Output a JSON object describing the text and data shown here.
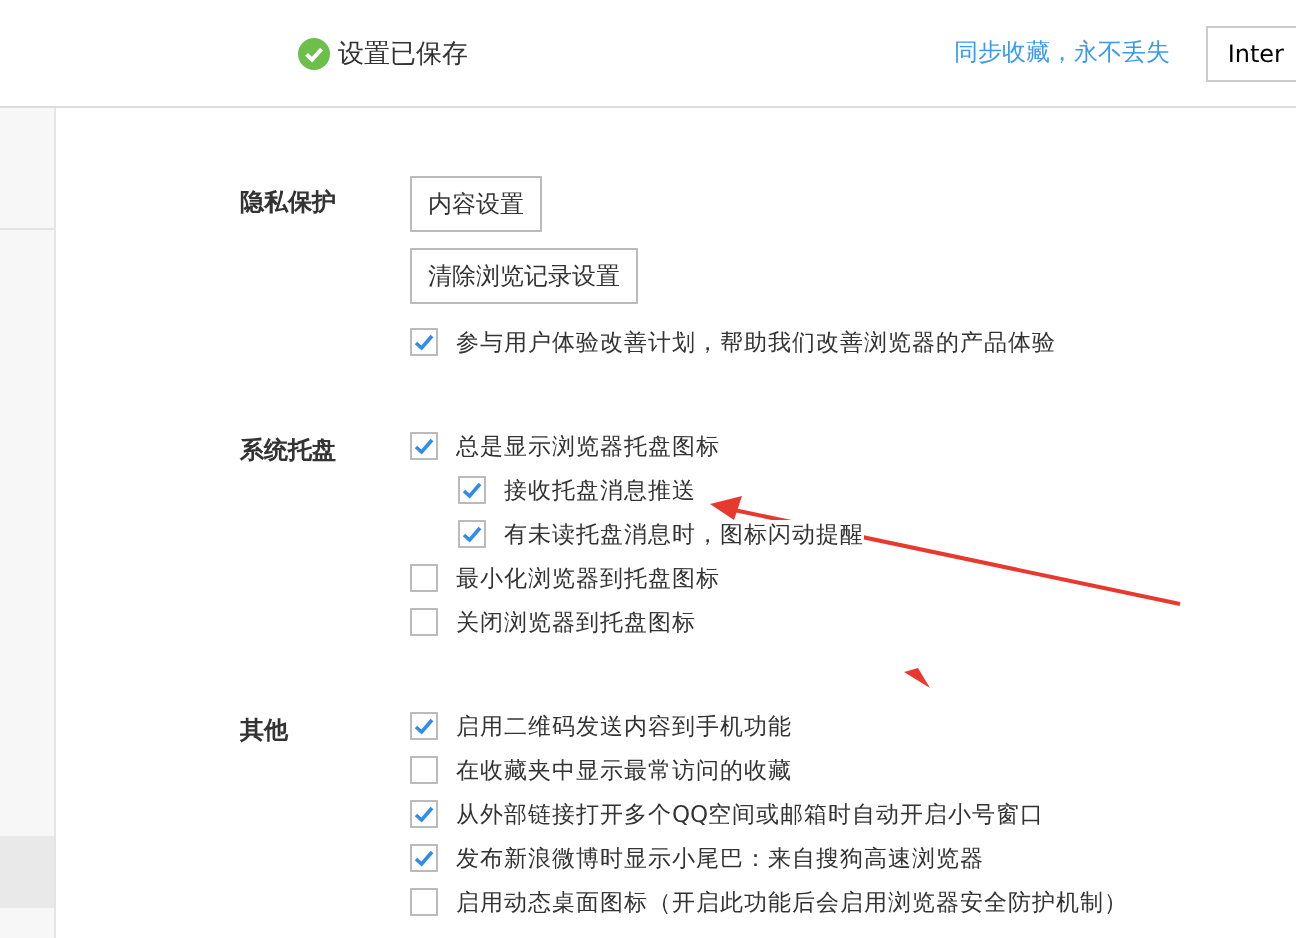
{
  "header": {
    "status": "设置已保存",
    "sync_link": "同步收藏，永不丢失",
    "button": "Inter"
  },
  "sections": [
    {
      "label": "隐私保护",
      "items": [
        {
          "kind": "button",
          "text": "内容设置"
        },
        {
          "kind": "button",
          "text": "清除浏览记录设置"
        },
        {
          "kind": "checkbox",
          "text": "参与用户体验改善计划，帮助我们改善浏览器的产品体验",
          "checked": true
        }
      ]
    },
    {
      "label": "系统托盘",
      "items": [
        {
          "kind": "checkbox",
          "text": "总是显示浏览器托盘图标",
          "checked": true,
          "children": [
            {
              "text": "接收托盘消息推送",
              "checked": true
            },
            {
              "text": "有未读托盘消息时，图标闪动提醒",
              "checked": true
            }
          ]
        },
        {
          "kind": "checkbox",
          "text": "最小化浏览器到托盘图标",
          "checked": false
        },
        {
          "kind": "checkbox",
          "text": "关闭浏览器到托盘图标",
          "checked": false
        }
      ]
    },
    {
      "label": "其他",
      "items": [
        {
          "kind": "checkbox",
          "text": "启用二维码发送内容到手机功能",
          "checked": true
        },
        {
          "kind": "checkbox",
          "text": "在收藏夹中显示最常访问的收藏",
          "checked": false
        },
        {
          "kind": "checkbox",
          "text": "从外部链接打开多个QQ空间或邮箱时自动开启小号窗口",
          "checked": true
        },
        {
          "kind": "checkbox",
          "text": "发布新浪微博时显示小尾巴：来自搜狗高速浏览器",
          "checked": true
        },
        {
          "kind": "checkbox",
          "text": "启用动态桌面图标（开启此功能后会启用浏览器安全防护机制）",
          "checked": false
        }
      ]
    }
  ]
}
